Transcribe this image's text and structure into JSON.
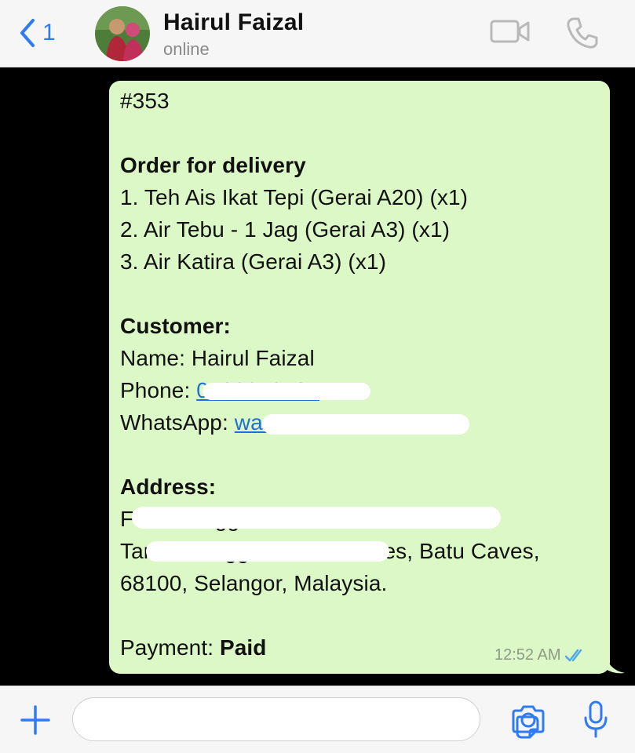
{
  "header": {
    "back_count": "1",
    "contact_name": "Hairul Faizal",
    "status": "online",
    "accent_color": "#2f7bf5"
  },
  "message": {
    "order_id": "#353",
    "order_heading": "Order for delivery",
    "items": [
      "1. Teh Ais Ikat Tepi (Gerai A20) (x1)",
      "2. Air Tebu - 1 Jag (Gerai A3) (x1)",
      "3. Air Katira (Gerai A3) (x1)"
    ],
    "customer_heading": "Customer:",
    "name_label": "Name:",
    "name_value": "Hairul Faizal",
    "phone_label": "Phone:",
    "phone_value": "0123312101",
    "whatsapp_label": "WhatsApp:",
    "whatsapp_value": "wa.me/60123312101",
    "address_heading": "Address:",
    "address_line1": "F   Flat Pinggiran Batu C",
    "address_line2": "Taman Pinggiran Batu Caves, Batu Caves,",
    "address_line3": "68100, Selangor, Malaysia.",
    "payment_label": "Payment:",
    "payment_value": "Paid",
    "time": "12:52 AM",
    "bubble_color": "#dcf8c6",
    "tick_color": "#4fa8e8"
  },
  "composer": {
    "placeholder": "",
    "icons": [
      "plus-icon",
      "sticker-icon",
      "camera-icon",
      "microphone-icon"
    ]
  }
}
